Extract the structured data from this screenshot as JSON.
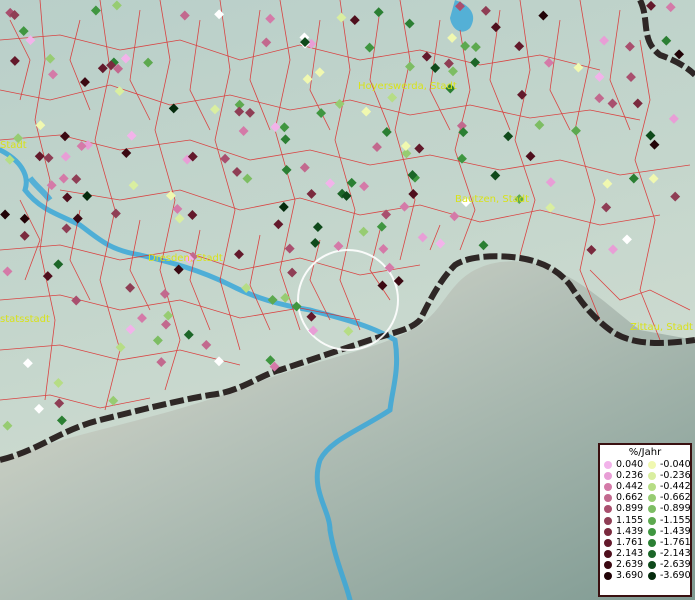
{
  "map": {
    "cities": [
      {
        "name": "Hoyerswerda, Stadt"
      },
      {
        "name": "Bautzen, Stadt"
      },
      {
        "name": "Dresden, Stadt"
      },
      {
        "name": "Zittau, Stadt"
      },
      {
        "name": "Stadt"
      },
      {
        "name": "statsstadt"
      }
    ]
  },
  "legend": {
    "title": "%/Jahr",
    "positive": [
      "0.040",
      "0.236",
      "0.442",
      "0.662",
      "0.899",
      "1.155",
      "1.439",
      "1.761",
      "2.143",
      "2.639",
      "3.690"
    ],
    "negative": [
      "-0.040",
      "-0.236",
      "-0.442",
      "-0.662",
      "-0.899",
      "-1.155",
      "-1.439",
      "-1.761",
      "-2.143",
      "-2.639",
      "-3.690"
    ],
    "positive_colors": [
      "#f2b3ea",
      "#e89ed6",
      "#d47aa8",
      "#c2698e",
      "#a94f6e",
      "#8f3e55",
      "#7a2a3e",
      "#63192b",
      "#4f0f1d",
      "#3b0912",
      "#220307"
    ],
    "negative_colors": [
      "#f0f8b0",
      "#d9eea0",
      "#b6dd85",
      "#97cc72",
      "#7dbd63",
      "#5da94f",
      "#3f9640",
      "#2b7f33",
      "#1c6628",
      "#0f4a1b",
      "#052b0d"
    ]
  }
}
